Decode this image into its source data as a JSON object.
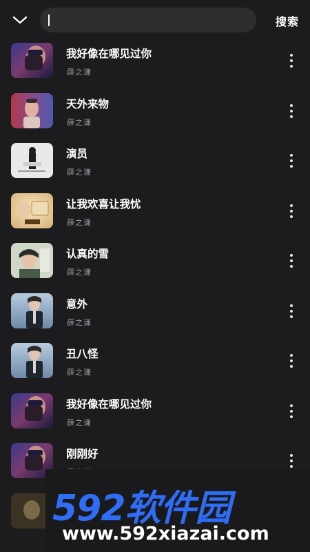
{
  "header": {
    "search_value": "",
    "search_button_label": "搜索",
    "back_icon": "chevron-down-icon"
  },
  "songs": [
    {
      "title": "我好像在哪见过你",
      "artist": "薛之谦"
    },
    {
      "title": "天外来物",
      "artist": "薛之谦"
    },
    {
      "title": "演员",
      "artist": "薛之谦"
    },
    {
      "title": "让我欢喜让我忧",
      "artist": "薛之谦"
    },
    {
      "title": "认真的雪",
      "artist": "薛之谦"
    },
    {
      "title": "意外",
      "artist": "薛之谦"
    },
    {
      "title": "丑八怪",
      "artist": "薛之谦"
    },
    {
      "title": "我好像在哪见过你",
      "artist": "薛之谦"
    },
    {
      "title": "刚刚好",
      "artist": "薛之谦"
    }
  ],
  "watermark": {
    "brand": "592软件园",
    "url": "www.592xiazai.com"
  },
  "colors": {
    "background": "#1c1c1e",
    "watermark_blue": "#2f6df5"
  }
}
